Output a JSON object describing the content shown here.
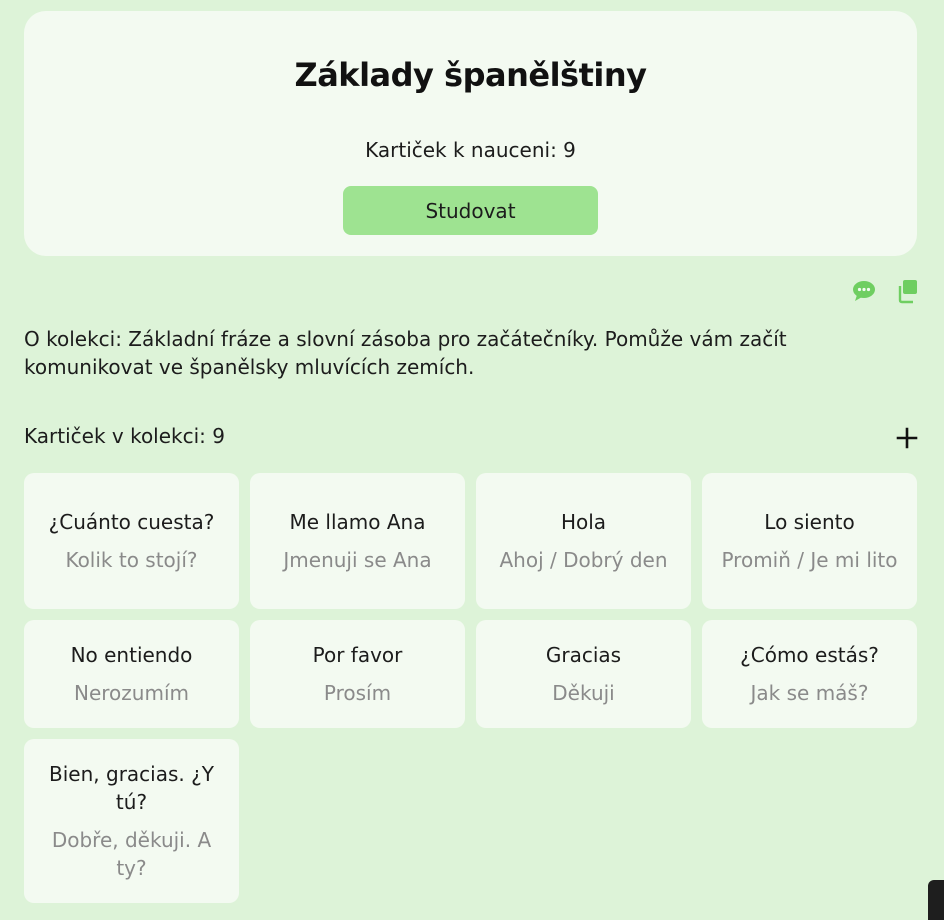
{
  "collection": {
    "title": "Základy španělštiny",
    "to_learn": "Kartiček k nauceni: 9",
    "study_label": "Studovat",
    "about": "O kolekci: Základní fráze a slovní zásoba pro začátečníky. Pomůže vám začít komunikovat ve španělsky mluvících zemích.",
    "card_count": "Kartiček v kolekci: 9",
    "add_symbol": "+"
  },
  "icons": {
    "comment": "comment-icon",
    "copy": "copy-icon",
    "add": "plus-icon",
    "accent_color": "#6fce61"
  },
  "cards": [
    {
      "front": "¿Cuánto cuesta?",
      "back": "Kolik to stojí?"
    },
    {
      "front": "Me llamo Ana",
      "back": "Jmenuji se Ana"
    },
    {
      "front": "Hola",
      "back": "Ahoj / Dobrý den"
    },
    {
      "front": "Lo siento",
      "back": "Promiň / Je mi lito"
    },
    {
      "front": "No entiendo",
      "back": "Nerozumím"
    },
    {
      "front": "Por favor",
      "back": "Prosím"
    },
    {
      "front": "Gracias",
      "back": "Děkuji"
    },
    {
      "front": "¿Cómo estás?",
      "back": "Jak se máš?"
    },
    {
      "front": "Bien, gracias. ¿Y tú?",
      "back": "Dobře, děkuji. A ty?"
    }
  ]
}
